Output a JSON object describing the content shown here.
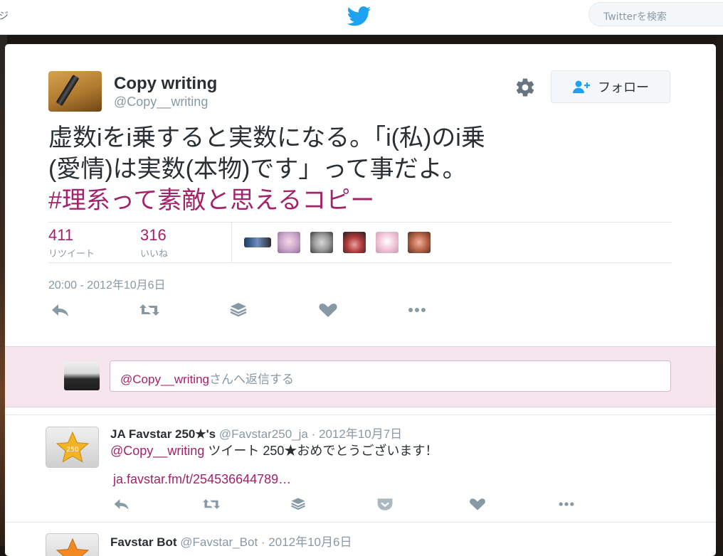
{
  "topbar": {
    "clipped_label": "ジ",
    "search_placeholder": "Twitterを検索"
  },
  "tweet": {
    "author_name": "Copy writing",
    "author_handle": "@Copy__writing",
    "follow_label": "フォロー",
    "text_lines": [
      "虚数iをi乗すると実数になる。「i(私)のi乗",
      "(愛情)は実数(本物)です」って事だよ。"
    ],
    "hashtag": "#理系って素敵と思えるコピー",
    "retweets": {
      "count": "411",
      "label": "リツイート"
    },
    "likes": {
      "count": "316",
      "label": "いいね"
    },
    "timestamp": "20:00 - 2012年10月6日",
    "actions": [
      "reply-icon",
      "retweet-icon",
      "layers-icon",
      "heart-icon",
      "more-icon"
    ]
  },
  "reply_box": {
    "mention": "@Copy__writing",
    "suffix": "さんへ返信する"
  },
  "replies": [
    {
      "name": "JA Favstar 250★'s",
      "handle": "@Favstar250_ja",
      "sep": " · ",
      "date": "2012年10月7日",
      "avatar_badge": "250",
      "mention": "@Copy__writing",
      "text": " ツイート 250★おめでとうございます！",
      "link": "ja.favstar.fm/t/254536644789…"
    },
    {
      "name": "Favstar Bot",
      "handle": "@Favstar_Bot",
      "sep": " · ",
      "date": "2012年10月6日"
    }
  ],
  "colors": {
    "accent": "#a3226a",
    "twitter_blue": "#1da1f2",
    "muted": "#8899a6",
    "reply_bg": "#f5e6ee"
  }
}
